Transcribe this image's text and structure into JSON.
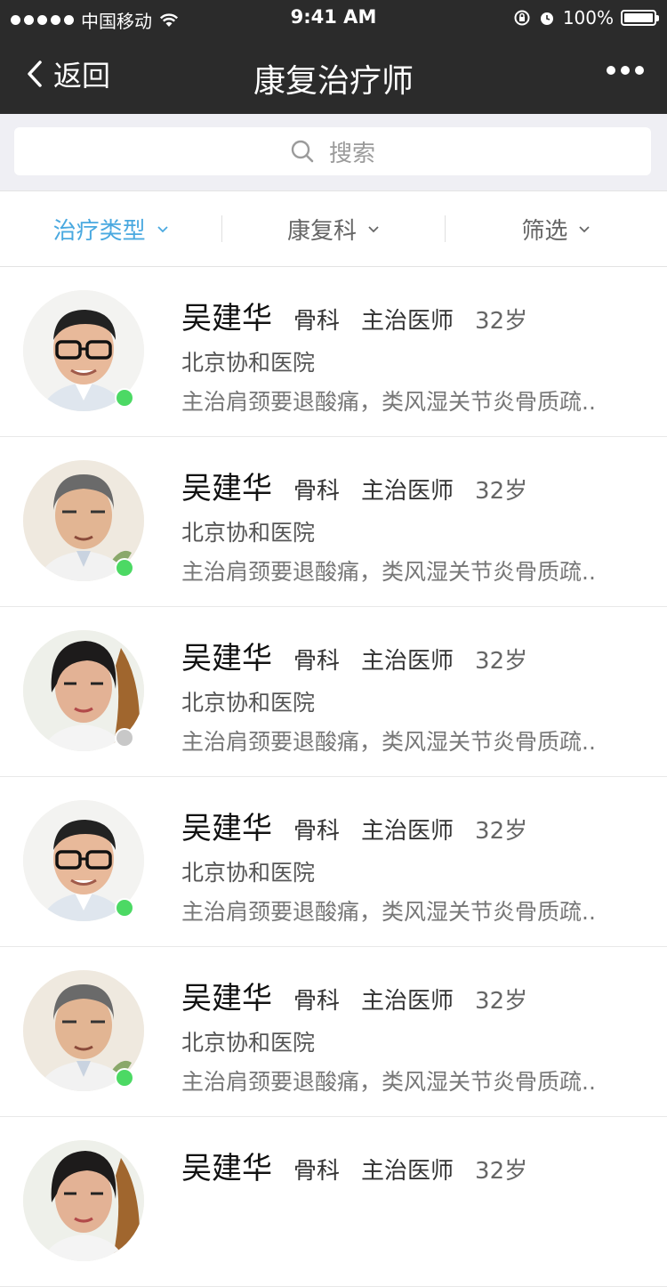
{
  "status_bar": {
    "carrier": "中国移动",
    "time": "9:41 AM",
    "battery": "100%",
    "battery_level": 1.0
  },
  "nav": {
    "back_label": "返回",
    "title": "康复治疗师"
  },
  "search": {
    "placeholder": "搜索"
  },
  "filters": [
    {
      "label": "治疗类型",
      "active": true
    },
    {
      "label": "康复科",
      "active": false
    },
    {
      "label": "筛选",
      "active": false
    }
  ],
  "colors": {
    "accent": "#4aa9e0",
    "online": "#4cd964",
    "offline": "#c8c8c8",
    "nav_bg": "#2b2b2b"
  },
  "doctors": [
    {
      "name": "吴建华",
      "department": "骨科",
      "title": "主治医师",
      "age": "32岁",
      "hospital": "北京协和医院",
      "description": "主治肩颈要退酸痛，类风湿关节炎骨质疏..",
      "online": true,
      "avatar": "young-male-glasses"
    },
    {
      "name": "吴建华",
      "department": "骨科",
      "title": "主治医师",
      "age": "32岁",
      "hospital": "北京协和医院",
      "description": "主治肩颈要退酸痛，类风湿关节炎骨质疏..",
      "online": true,
      "avatar": "older-male"
    },
    {
      "name": "吴建华",
      "department": "骨科",
      "title": "主治医师",
      "age": "32岁",
      "hospital": "北京协和医院",
      "description": "主治肩颈要退酸痛，类风湿关节炎骨质疏..",
      "online": false,
      "avatar": "female"
    },
    {
      "name": "吴建华",
      "department": "骨科",
      "title": "主治医师",
      "age": "32岁",
      "hospital": "北京协和医院",
      "description": "主治肩颈要退酸痛，类风湿关节炎骨质疏..",
      "online": true,
      "avatar": "young-male-glasses"
    },
    {
      "name": "吴建华",
      "department": "骨科",
      "title": "主治医师",
      "age": "32岁",
      "hospital": "北京协和医院",
      "description": "主治肩颈要退酸痛，类风湿关节炎骨质疏..",
      "online": true,
      "avatar": "older-male"
    },
    {
      "name": "吴建华",
      "department": "骨科",
      "title": "主治医师",
      "age": "32岁",
      "hospital": "",
      "description": "",
      "online": null,
      "avatar": "female"
    }
  ]
}
